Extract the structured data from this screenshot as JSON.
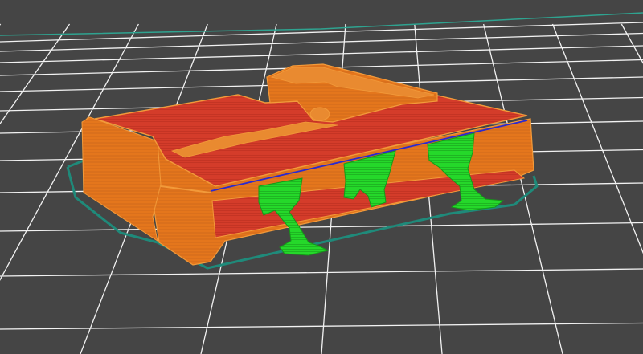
{
  "app": {
    "view": "slicer-preview-3d"
  },
  "scene": {
    "background_color": "#454545",
    "grid_line_color": "#f2f2f2",
    "bed_edge_color": "#2fa390",
    "skirt_color": "#1f8a7a",
    "shell_color": "#e4761c",
    "shell_edge_color": "#f29a3a",
    "infill_color": "#d43c2a",
    "support_color": "#25d82a",
    "support_dark_color": "#149a18",
    "accent_line_color": "#2a2ad0"
  },
  "icons": {
    "printed-part": "printed-part-icon",
    "support": "support-icon"
  }
}
